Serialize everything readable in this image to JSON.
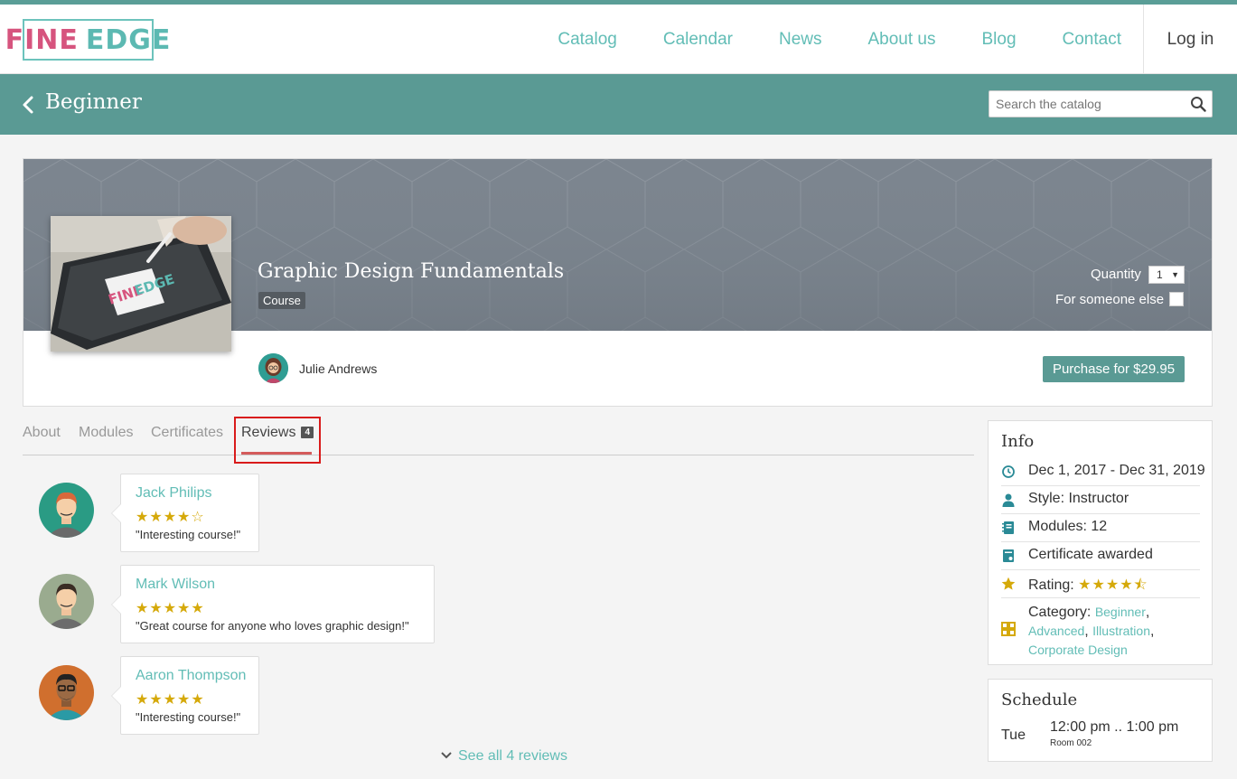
{
  "header": {
    "logo": {
      "part1": "FINE",
      "part2": "EDGE"
    },
    "nav": [
      "Catalog",
      "Calendar",
      "News",
      "About us",
      "Blog",
      "Contact"
    ],
    "login": "Log in"
  },
  "subheader": {
    "title": "Beginner",
    "search_placeholder": "Search the catalog"
  },
  "course": {
    "title": "Graphic Design Fundamentals",
    "tag": "Course",
    "quantity_label": "Quantity",
    "quantity_value": "1",
    "someone_else_label": "For someone else",
    "instructor": "Julie Andrews",
    "purchase_label": "Purchase for $29.95",
    "thumb_logo": {
      "part1": "FINE",
      "part2": "EDGE"
    }
  },
  "tabs": [
    {
      "label": "About"
    },
    {
      "label": "Modules"
    },
    {
      "label": "Certificates"
    },
    {
      "label": "Reviews",
      "badge": "4"
    }
  ],
  "reviews": [
    {
      "name": "Jack Philips",
      "stars": "★★★★☆",
      "rating": 4,
      "text": "\"Interesting course!\""
    },
    {
      "name": "Mark Wilson",
      "stars": "★★★★★",
      "rating": 5,
      "text": "\"Great course for anyone who loves graphic design!\""
    },
    {
      "name": "Aaron Thompson",
      "stars": "★★★★★",
      "rating": 5,
      "text": "\"Interesting course!\""
    }
  ],
  "see_all": "See all 4 reviews",
  "info": {
    "title": "Info",
    "dates": "Dec 1, 2017 - Dec 31, 2019",
    "style": "Style: Instructor",
    "modules": "Modules: 12",
    "certificate": "Certificate awarded",
    "rating_label": "Rating:",
    "rating_stars": "★★★★⯪",
    "rating_value": 4.5,
    "category_label": "Category: ",
    "categories": [
      "Beginner",
      "Advanced",
      "Illustration",
      "Corporate Design"
    ]
  },
  "schedule": {
    "title": "Schedule",
    "day": "Tue",
    "time": "12:00 pm .. 1:00 pm",
    "room": "Room 002"
  },
  "colors": {
    "teal": "#5a9a94",
    "link": "#62bdb6",
    "pink": "#d6547e",
    "star": "#d5a90a",
    "highlight": "#d91b1b"
  }
}
